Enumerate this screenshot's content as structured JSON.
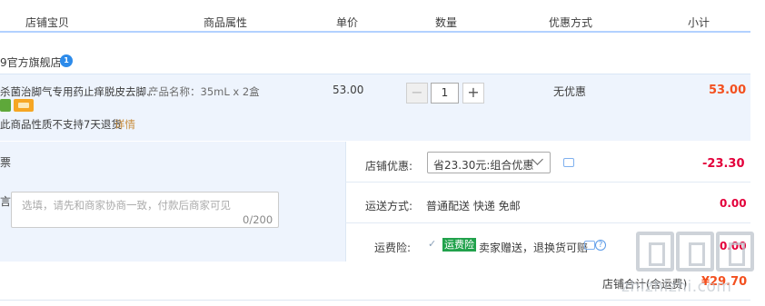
{
  "header": {
    "col_shop": "店铺宝贝",
    "col_attr": "商品属性",
    "col_price": "单价",
    "col_qty": "数量",
    "col_promo": "优惠方式",
    "col_subtotal": "小计"
  },
  "shop": {
    "name": "9官方旗舰店",
    "badge": "1"
  },
  "item": {
    "title": "杀菌治脚气专用药止痒脱皮去脚...",
    "attr": "产品名称：35mL x 2盒",
    "price": "53.00",
    "quantity": "1",
    "minus": "−",
    "plus": "+",
    "promo": "无优惠",
    "total": "53.00",
    "note": "此商品性质不支持7天退货",
    "note_link": "详情"
  },
  "order": {
    "invoice_label": "票",
    "message_label": "言:",
    "message_placeholder": "选填，请先和商家协商一致，付款后商家可见",
    "message_count": "0/200",
    "shop_promo_label": "店铺优惠:",
    "shop_promo_value": "省23.30元:组合优惠",
    "shop_promo_discount": "-23.30",
    "shipping_label": "运送方式:",
    "shipping_value": "普通配送 快递 免邮",
    "shipping_cost": "0.00",
    "insurance_label": "运费险:",
    "insurance_badge": "运费险",
    "insurance_text": "卖家赠送，退换货可赔",
    "insurance_cost": "0.00",
    "check_mark": "✓",
    "help_mark": "?"
  },
  "summary": {
    "label": "店铺合计(含运费)",
    "value": "¥29.70"
  },
  "watermark": {
    "text": "zhizhizhi.com"
  },
  "colors": {
    "accent_red": "#e3003b",
    "price_orange": "#f3501f",
    "item_bg": "#eef4fd",
    "header_line": "#b2d1ff",
    "insurance_green": "#21a24c"
  }
}
